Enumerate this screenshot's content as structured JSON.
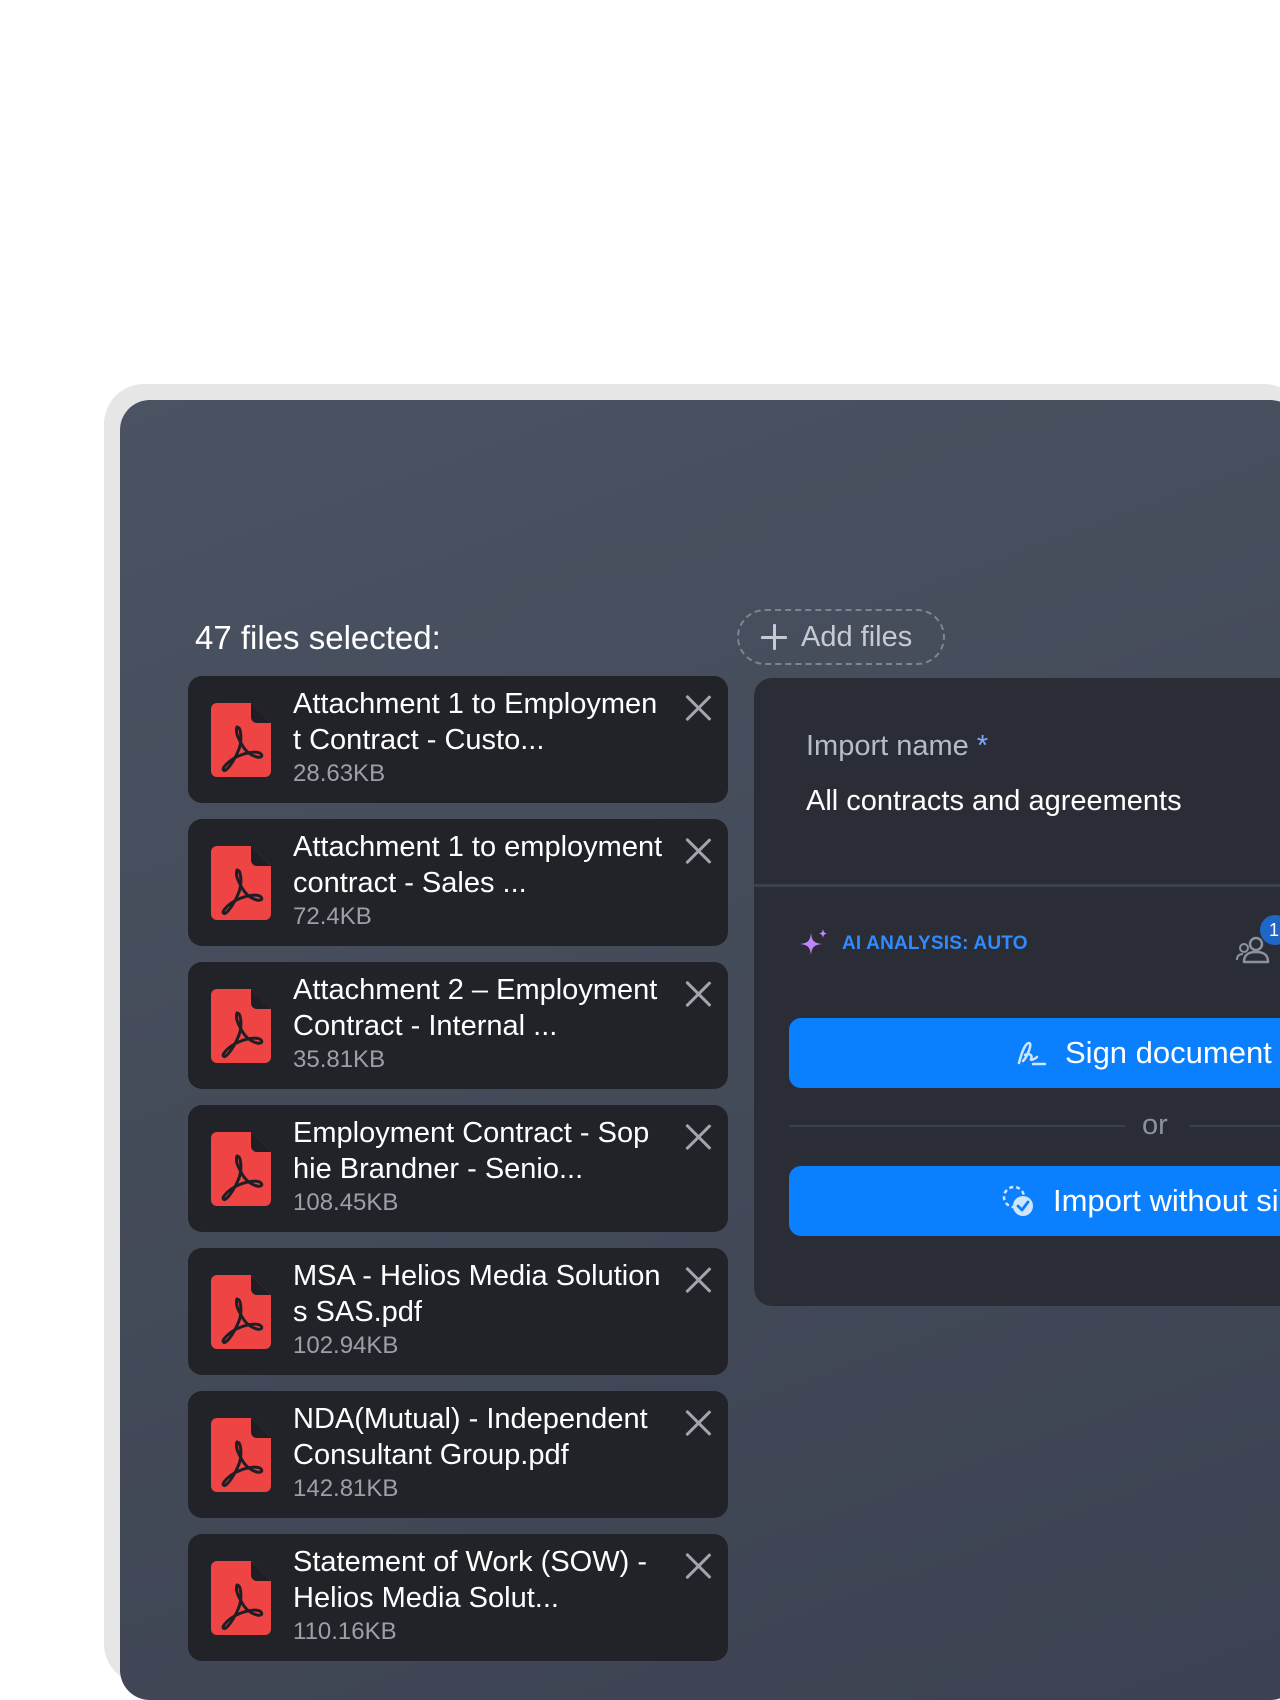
{
  "files_header": {
    "title": "47 files selected:"
  },
  "add_files": {
    "label": "Add files"
  },
  "files": [
    {
      "name": "Attachment 1 to Employment Contract - Custo...",
      "size": "28.63KB"
    },
    {
      "name": "Attachment 1 to employment contract - Sales ...",
      "size": "72.4KB"
    },
    {
      "name": "Attachment 2 – Employment Contract - Internal ...",
      "size": "35.81KB"
    },
    {
      "name": "Employment Contract - Sophie Brandner - Senio...",
      "size": "108.45KB"
    },
    {
      "name": "MSA - Helios Media Solutions SAS.pdf",
      "size": "102.94KB"
    },
    {
      "name": "NDA(Mutual) - Independent Consultant Group.pdf",
      "size": "142.81KB"
    },
    {
      "name": "Statement of Work (SOW) - Helios Media Solut...",
      "size": "110.16KB"
    }
  ],
  "import_panel": {
    "label": "Import name",
    "required_mark": "*",
    "value": "All contracts and agreements",
    "ai_analysis_label": "AI ANALYSIS: AUTO",
    "participants_badge": "1",
    "sign_button": "Sign document",
    "or_text": "or",
    "import_button": "Import without sig"
  },
  "colors": {
    "accent_blue": "#0a80ff",
    "pdf_red": "#ef4444",
    "ai_purple": "#c084fc",
    "ai_blue": "#2f8bff"
  },
  "icons": {
    "file": "pdf-icon",
    "remove": "close-icon",
    "add": "plus-icon",
    "ai": "sparkle-icon",
    "participants": "people-icon",
    "sign": "signature-icon",
    "import": "import-check-icon"
  }
}
